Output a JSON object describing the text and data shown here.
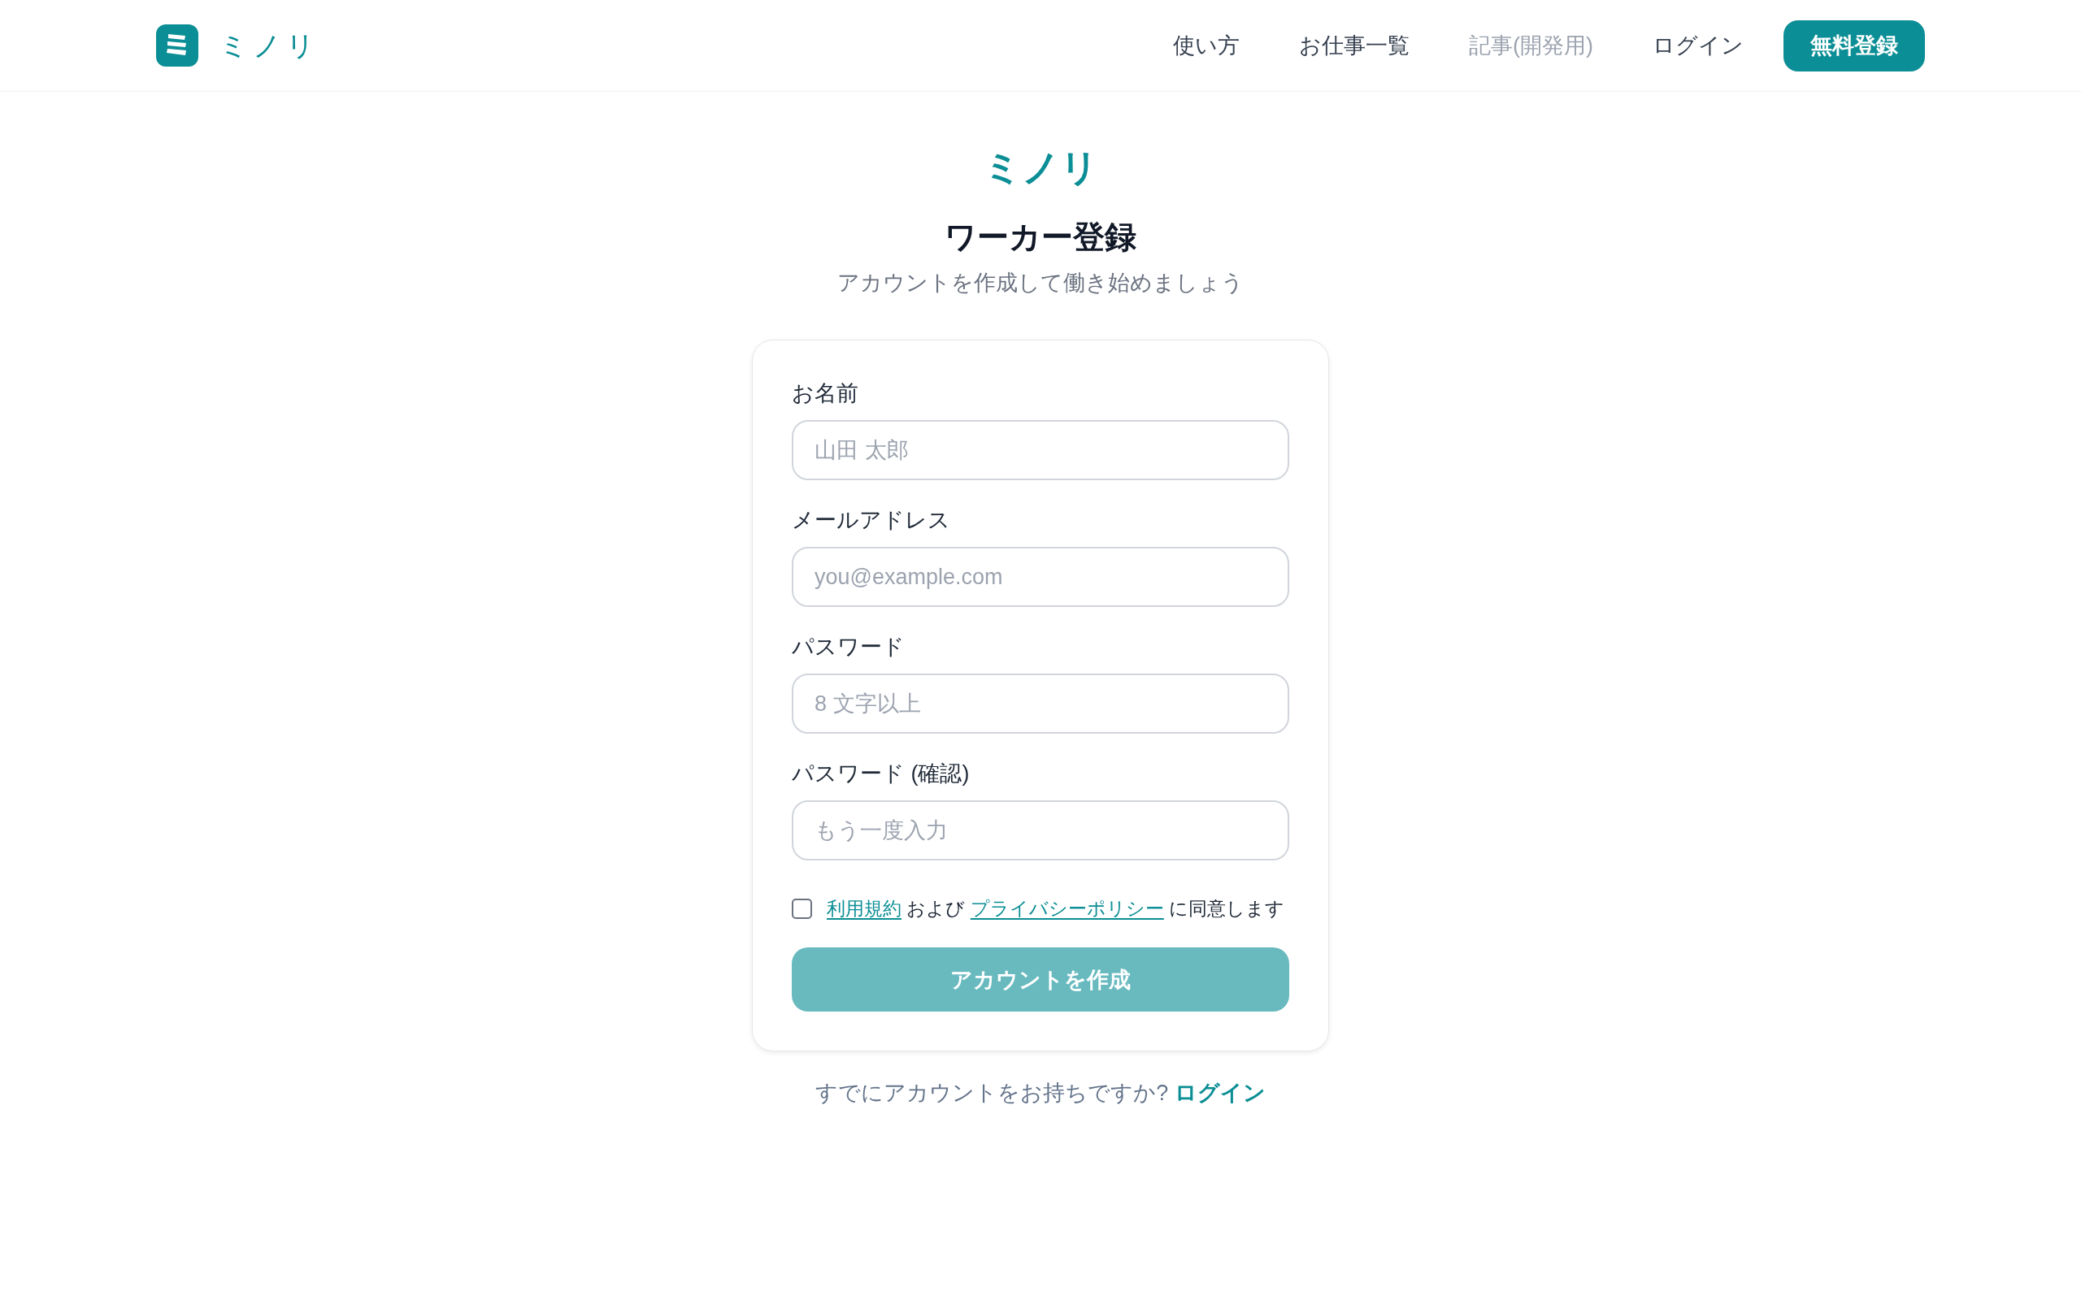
{
  "header": {
    "logo": "ミノリ",
    "nav": [
      {
        "label": "使い方",
        "disabled": false
      },
      {
        "label": "お仕事一覧",
        "disabled": false
      },
      {
        "label": "記事(開発用)",
        "disabled": true
      },
      {
        "label": "ログイン",
        "disabled": false
      }
    ],
    "cta": "無料登録"
  },
  "brand": "ミノリ",
  "title": "ワーカー登録",
  "subtitle": "アカウントを作成して働き始めましょう",
  "form": {
    "fields": [
      {
        "label": "お名前",
        "placeholder": "山田 太郎"
      },
      {
        "label": "メールアドレス",
        "placeholder": "you@example.com"
      },
      {
        "label": "パスワード",
        "placeholder": "8 文字以上"
      },
      {
        "label": "パスワード (確認)",
        "placeholder": "もう一度入力"
      }
    ],
    "agreement": {
      "checked": false,
      "parts": [
        {
          "kind": "link",
          "text": "利用規約"
        },
        {
          "kind": "text",
          "text": "および"
        },
        {
          "kind": "link",
          "text": "プライバシーポリシー"
        },
        {
          "kind": "text",
          "text": "に同意します"
        }
      ]
    },
    "submit": {
      "label": "アカウントを作成",
      "disabled": true
    }
  },
  "footer": {
    "text": "すでにアカウントをお持ちですか?",
    "link": "ログイン"
  }
}
